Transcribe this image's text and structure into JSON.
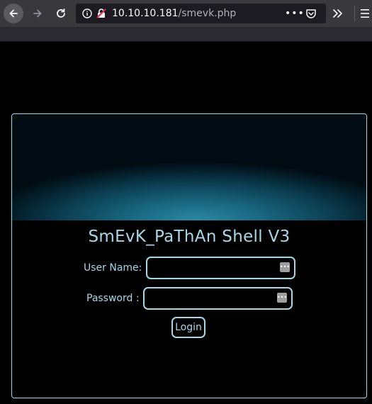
{
  "browser": {
    "url_host": "10.10.10.181",
    "url_path": "/smevk.php",
    "page_actions": "•••"
  },
  "form": {
    "title": "SmEvK_PaThAn Shell V3",
    "username_label": "User Name:",
    "password_label": "Password :",
    "login_label": "Login"
  },
  "colors": {
    "accent": "#a7d8e6",
    "background": "#000000",
    "toolbar": "#38383d"
  },
  "icons": [
    "back-arrow-icon",
    "forward-arrow-icon",
    "reload-icon",
    "info-icon",
    "insecure-lock-icon",
    "pocket-icon",
    "overflow-chevron-icon",
    "hamburger-menu-icon",
    "password-key-icon"
  ]
}
